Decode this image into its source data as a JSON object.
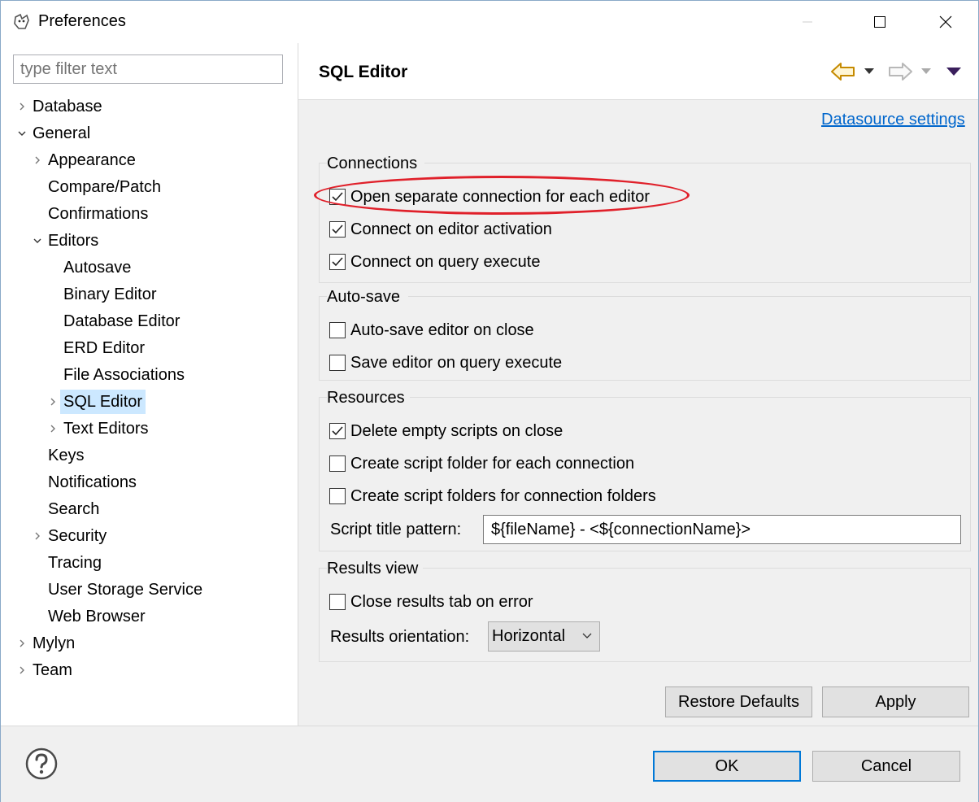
{
  "window": {
    "title": "Preferences",
    "accent": "#0078d7",
    "selection_color": "#cce8ff",
    "link_color": "#0066cc",
    "highlight_color": "#e0202a"
  },
  "filter": {
    "placeholder": "type filter text"
  },
  "tree": {
    "items": [
      {
        "label": "Database",
        "twisty": "collapsed"
      },
      {
        "label": "General",
        "twisty": "expanded"
      },
      {
        "label": "Appearance",
        "twisty": "collapsed"
      },
      {
        "label": "Compare/Patch",
        "twisty": "none"
      },
      {
        "label": "Confirmations",
        "twisty": "none"
      },
      {
        "label": "Editors",
        "twisty": "expanded"
      },
      {
        "label": "Autosave",
        "twisty": "none"
      },
      {
        "label": "Binary Editor",
        "twisty": "none"
      },
      {
        "label": "Database Editor",
        "twisty": "none"
      },
      {
        "label": "ERD Editor",
        "twisty": "none"
      },
      {
        "label": "File Associations",
        "twisty": "none"
      },
      {
        "label": "SQL Editor",
        "twisty": "collapsed",
        "selected": true
      },
      {
        "label": "Text Editors",
        "twisty": "collapsed"
      },
      {
        "label": "Keys",
        "twisty": "none"
      },
      {
        "label": "Notifications",
        "twisty": "none"
      },
      {
        "label": "Search",
        "twisty": "none"
      },
      {
        "label": "Security",
        "twisty": "collapsed"
      },
      {
        "label": "Tracing",
        "twisty": "none"
      },
      {
        "label": "User Storage Service",
        "twisty": "none"
      },
      {
        "label": "Web Browser",
        "twisty": "none"
      },
      {
        "label": "Mylyn",
        "twisty": "collapsed"
      },
      {
        "label": "Team",
        "twisty": "collapsed"
      }
    ]
  },
  "page": {
    "title": "SQL Editor",
    "datasource_link": "Datasource settings"
  },
  "groups": {
    "connections": {
      "title": "Connections",
      "options": [
        {
          "label": "Open separate connection for each editor",
          "checked": true
        },
        {
          "label": "Connect on editor activation",
          "checked": true
        },
        {
          "label": "Connect on query execute",
          "checked": true
        }
      ]
    },
    "autosave": {
      "title": "Auto-save",
      "options": [
        {
          "label": "Auto-save editor on close",
          "checked": false
        },
        {
          "label": "Save editor on query execute",
          "checked": false
        }
      ]
    },
    "resources": {
      "title": "Resources",
      "options": [
        {
          "label": "Delete empty scripts on close",
          "checked": true
        },
        {
          "label": "Create script folder for each connection",
          "checked": false
        },
        {
          "label": "Create script folders for connection folders",
          "checked": false
        }
      ],
      "script_title_label": "Script title pattern:",
      "script_title_value": "${fileName} - <${connectionName}>"
    },
    "results": {
      "title": "Results view",
      "options": [
        {
          "label": "Close results tab on error",
          "checked": false
        }
      ],
      "orientation_label": "Results orientation:",
      "orientation_value": "Horizontal"
    }
  },
  "buttons": {
    "restore_defaults": "Restore Defaults",
    "apply": "Apply",
    "ok": "OK",
    "cancel": "Cancel"
  }
}
